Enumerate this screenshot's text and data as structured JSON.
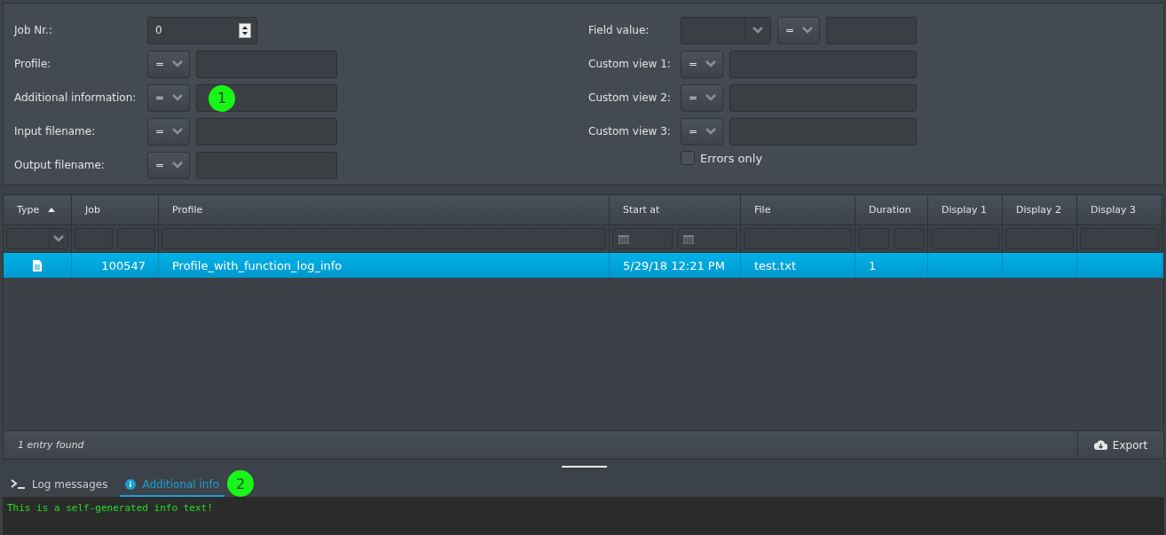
{
  "filters": {
    "left": [
      {
        "label": "Job Nr.:",
        "kind": "spinner",
        "value": "0"
      },
      {
        "label": "Profile:",
        "kind": "text",
        "operator": "="
      },
      {
        "label": "Additional information:",
        "kind": "text",
        "operator": "=",
        "callout": "1"
      },
      {
        "label": "Input filename:",
        "kind": "text",
        "operator": "="
      },
      {
        "label": "Output filename:",
        "kind": "text",
        "operator": "="
      }
    ],
    "right": [
      {
        "label": "Field value:",
        "kind": "field-select",
        "operator": "="
      },
      {
        "label": "Custom view 1:",
        "kind": "text",
        "operator": "="
      },
      {
        "label": "Custom view 2:",
        "kind": "text",
        "operator": "="
      },
      {
        "label": "Custom view 3:",
        "kind": "text",
        "operator": "="
      }
    ],
    "errors_only": {
      "label": "Errors only",
      "checked": false
    }
  },
  "table": {
    "columns": [
      {
        "label": "Type",
        "kind": "select",
        "sorted": true
      },
      {
        "label": "Job",
        "kind": "range",
        "sorted": false
      },
      {
        "label": "Profile",
        "kind": "text",
        "sorted": false
      },
      {
        "label": "Start at",
        "kind": "daterange",
        "sorted": false
      },
      {
        "label": "File",
        "kind": "text",
        "sorted": false
      },
      {
        "label": "Duration",
        "kind": "range",
        "sorted": false
      },
      {
        "label": "Display 1",
        "kind": "text",
        "sorted": false
      },
      {
        "label": "Display 2",
        "kind": "text",
        "sorted": false
      },
      {
        "label": "Display 3",
        "kind": "text",
        "sorted": false
      }
    ],
    "rows": [
      {
        "selected": true,
        "job": "100547",
        "profile": "Profile_with_function_log_info",
        "start_at": "5/29/18 12:21 PM",
        "file": "test.txt",
        "duration": "1"
      }
    ],
    "status": "1 entry found",
    "export_button": "Export"
  },
  "tabs": [
    {
      "label": "Log messages",
      "kind": "terminal",
      "selected": false
    },
    {
      "label": "Additional info",
      "kind": "info",
      "selected": true,
      "callout": "2"
    }
  ],
  "log_text": "This is a self-generated info text!"
}
